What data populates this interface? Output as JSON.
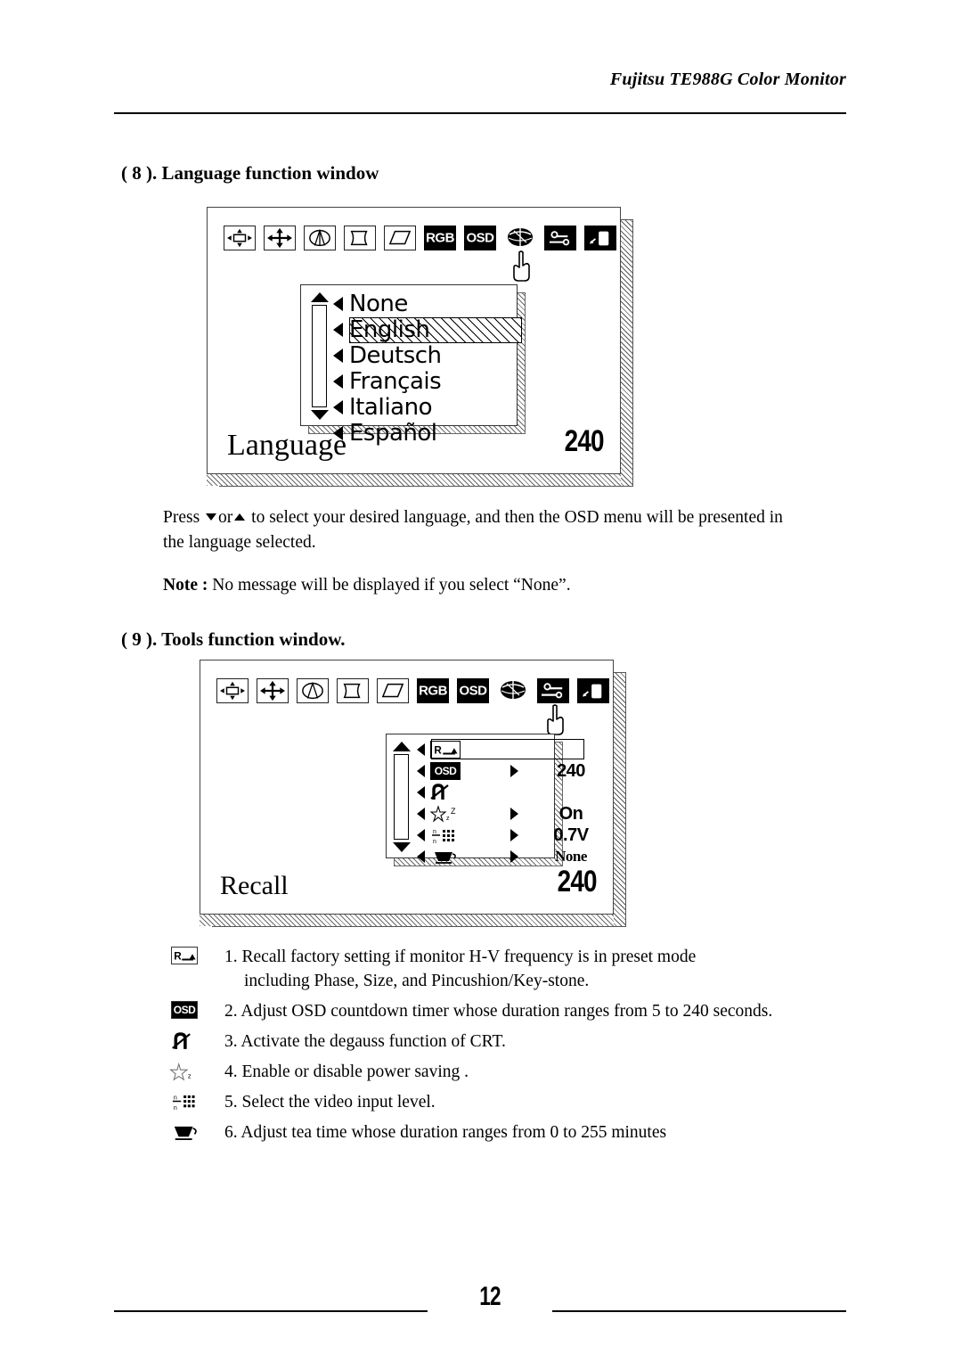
{
  "header": {
    "title": "Fujitsu TE988G Color Monitor"
  },
  "sections": {
    "language": {
      "heading": "( 8 ). Language function window",
      "paragraph_press_prefix": "Press",
      "paragraph_press_mid": "or",
      "paragraph_press_rest": "to select your desired language, and then the OSD menu will be presented in the language selected.",
      "note_label": "Note :",
      "note_text": "No message will be displayed if you select “None”."
    },
    "tools": {
      "heading": "( 9 ). Tools function window."
    }
  },
  "osd_language_window": {
    "icons": [
      {
        "name": "size-icon",
        "label": "",
        "style": "framed"
      },
      {
        "name": "position-icon",
        "label": "",
        "style": "framed"
      },
      {
        "name": "pincushion-icon",
        "label": "",
        "style": "framed"
      },
      {
        "name": "barrel-icon",
        "label": "",
        "style": "framed"
      },
      {
        "name": "parallelogram-icon",
        "label": "",
        "style": "framed"
      },
      {
        "name": "rgb-icon",
        "label": "RGB",
        "style": "inverted"
      },
      {
        "name": "osd-icon",
        "label": "OSD",
        "style": "inverted"
      },
      {
        "name": "globe-language-icon",
        "label": "",
        "style": "plain",
        "selected": true
      },
      {
        "name": "tools-icon",
        "label": "",
        "style": "inverted"
      },
      {
        "name": "monitor-exit-icon",
        "label": "",
        "style": "inverted"
      }
    ],
    "list": [
      {
        "label": "None",
        "selected": false
      },
      {
        "label": "English",
        "selected": true
      },
      {
        "label": "Deutsch",
        "selected": false
      },
      {
        "label": "Français",
        "selected": false
      },
      {
        "label": "ItaIiano",
        "selected": false
      },
      {
        "label": "Español",
        "selected": false
      }
    ],
    "footer_label": "Language",
    "footer_value": "240"
  },
  "osd_tools_window": {
    "icons": [
      {
        "name": "size-icon",
        "label": "",
        "style": "framed"
      },
      {
        "name": "position-icon",
        "label": "",
        "style": "framed"
      },
      {
        "name": "pincushion-icon",
        "label": "",
        "style": "framed"
      },
      {
        "name": "barrel-icon",
        "label": "",
        "style": "framed"
      },
      {
        "name": "parallelogram-icon",
        "label": "",
        "style": "framed"
      },
      {
        "name": "rgb-icon",
        "label": "RGB",
        "style": "inverted"
      },
      {
        "name": "osd-icon",
        "label": "OSD",
        "style": "inverted"
      },
      {
        "name": "globe-language-icon",
        "label": "",
        "style": "plain"
      },
      {
        "name": "tools-icon",
        "label": "",
        "style": "inverted",
        "selected": true
      },
      {
        "name": "monitor-exit-icon",
        "label": "",
        "style": "inverted"
      }
    ],
    "rows": [
      {
        "icon": "recall-icon",
        "icon_label": "R",
        "value": "",
        "selected": true,
        "has_right_caret": false
      },
      {
        "icon": "osd-timer-icon",
        "icon_label": "OSD",
        "value": "240",
        "selected": false,
        "has_right_caret": true
      },
      {
        "icon": "degauss-icon",
        "icon_label": "",
        "value": "",
        "selected": false,
        "has_right_caret": false
      },
      {
        "icon": "power-saving-icon",
        "icon_label": "",
        "value": "On",
        "selected": false,
        "has_right_caret": true
      },
      {
        "icon": "video-level-icon",
        "icon_label": "",
        "value": "0.7V",
        "selected": false,
        "has_right_caret": true
      },
      {
        "icon": "tea-time-icon",
        "icon_label": "",
        "value": "None",
        "selected": false,
        "has_right_caret": true
      }
    ],
    "footer_label": "Recall",
    "footer_value": "240"
  },
  "explanations": [
    {
      "icon": "recall-icon",
      "icon_label": "R",
      "text": "1. Recall factory setting if monitor H-V frequency is in preset mode",
      "continuation": "including Phase, Size, and Pincushion/Key-stone."
    },
    {
      "icon": "osd-timer-icon",
      "icon_label": "OSD",
      "text": "2. Adjust OSD countdown timer whose duration ranges from 5 to 240 seconds.",
      "continuation": ""
    },
    {
      "icon": "degauss-icon",
      "icon_label": "",
      "text": "3. Activate the degauss function of CRT.",
      "continuation": ""
    },
    {
      "icon": "power-saving-icon",
      "icon_label": "",
      "text": "4. Enable or disable power saving .",
      "continuation": ""
    },
    {
      "icon": "video-level-icon",
      "icon_label": "",
      "text": "5. Select the video input level.",
      "continuation": ""
    },
    {
      "icon": "tea-time-icon",
      "icon_label": "",
      "text": "6. Adjust tea time whose duration ranges from 0 to 255 minutes",
      "continuation": ""
    }
  ],
  "footer": {
    "page_number": "12"
  }
}
